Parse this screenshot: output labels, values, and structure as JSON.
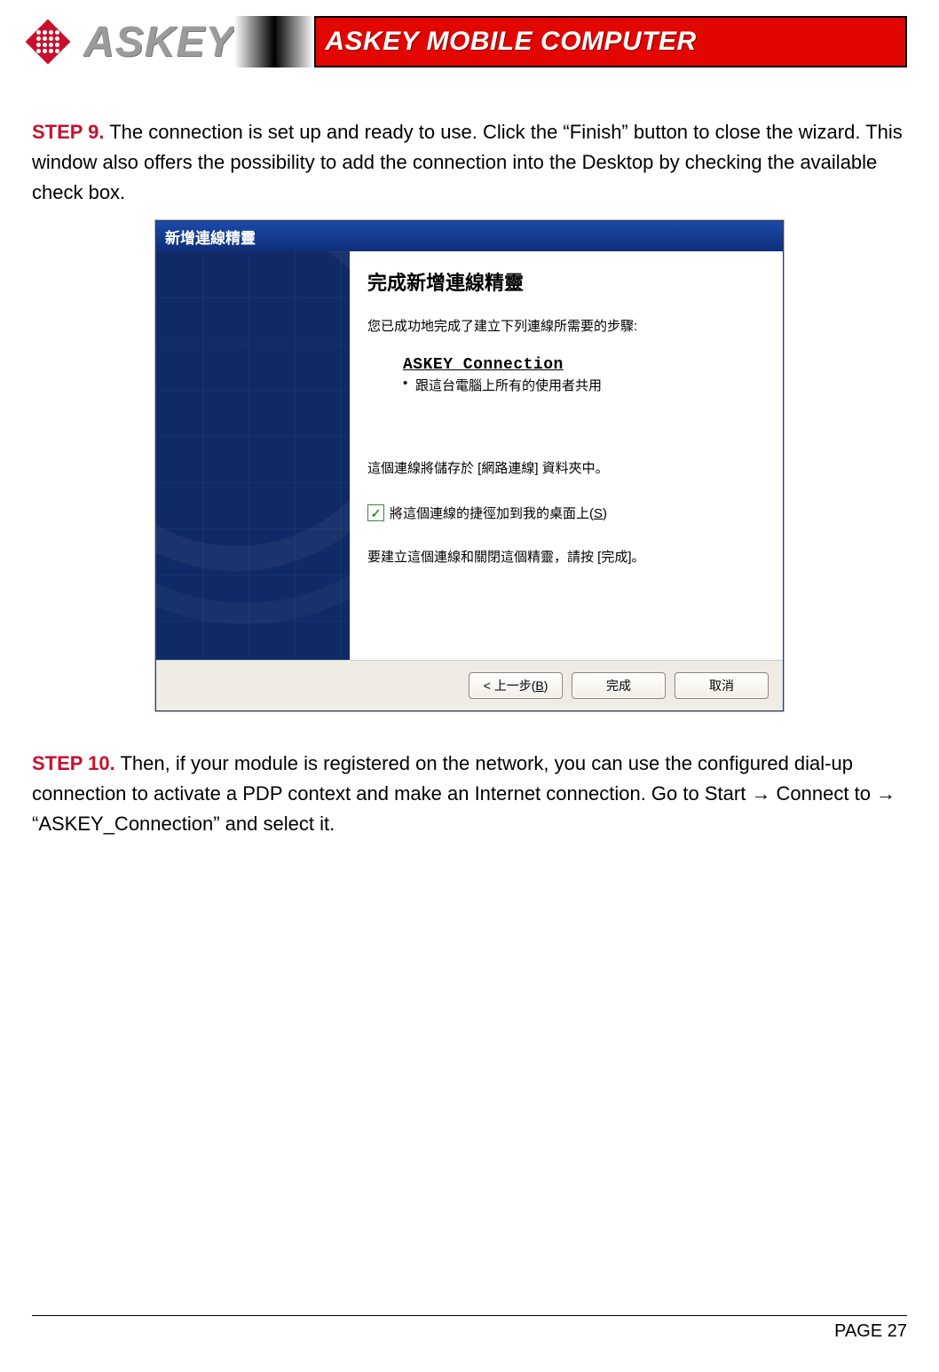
{
  "header": {
    "logo_word": "ASKEY",
    "banner_text": "ASKEY MOBILE COMPUTER"
  },
  "step9": {
    "label": "STEP 9.",
    "text": " The connection is set up and ready to use. Click the “Finish” button to close the wizard. This window also offers the possibility to add the connection into the Desktop by checking the available check box."
  },
  "wizard": {
    "title": "新增連線精靈",
    "heading": "完成新增連線精靈",
    "success_line": "您已成功地完成了建立下列連線所需要的步驟:",
    "connection_name": "ASKEY_Connection",
    "bullet": "跟這台電腦上所有的使用者共用",
    "store_line": "這個連線將儲存於 [網路連線] 資料夾中。",
    "checkbox_checked": true,
    "checkbox_text_pre": "將這個連線的捷徑加到我的桌面上(",
    "checkbox_text_key": "S",
    "checkbox_text_post": ")",
    "final_line": "要建立這個連線和關閉這個精靈，請按 [完成]。",
    "buttons": {
      "back_pre": "< 上一步(",
      "back_key": "B",
      "back_post": ")",
      "finish": "完成",
      "cancel": "取消"
    }
  },
  "step10": {
    "label": "STEP 10.",
    "text": " Then, if your module is registered on the network, you can use the configured dial-up connection to activate a PDP context and make an Internet connection. Go to Start → Connect to → “ASKEY_Connection” and select it."
  },
  "footer": {
    "page": "PAGE 27"
  }
}
